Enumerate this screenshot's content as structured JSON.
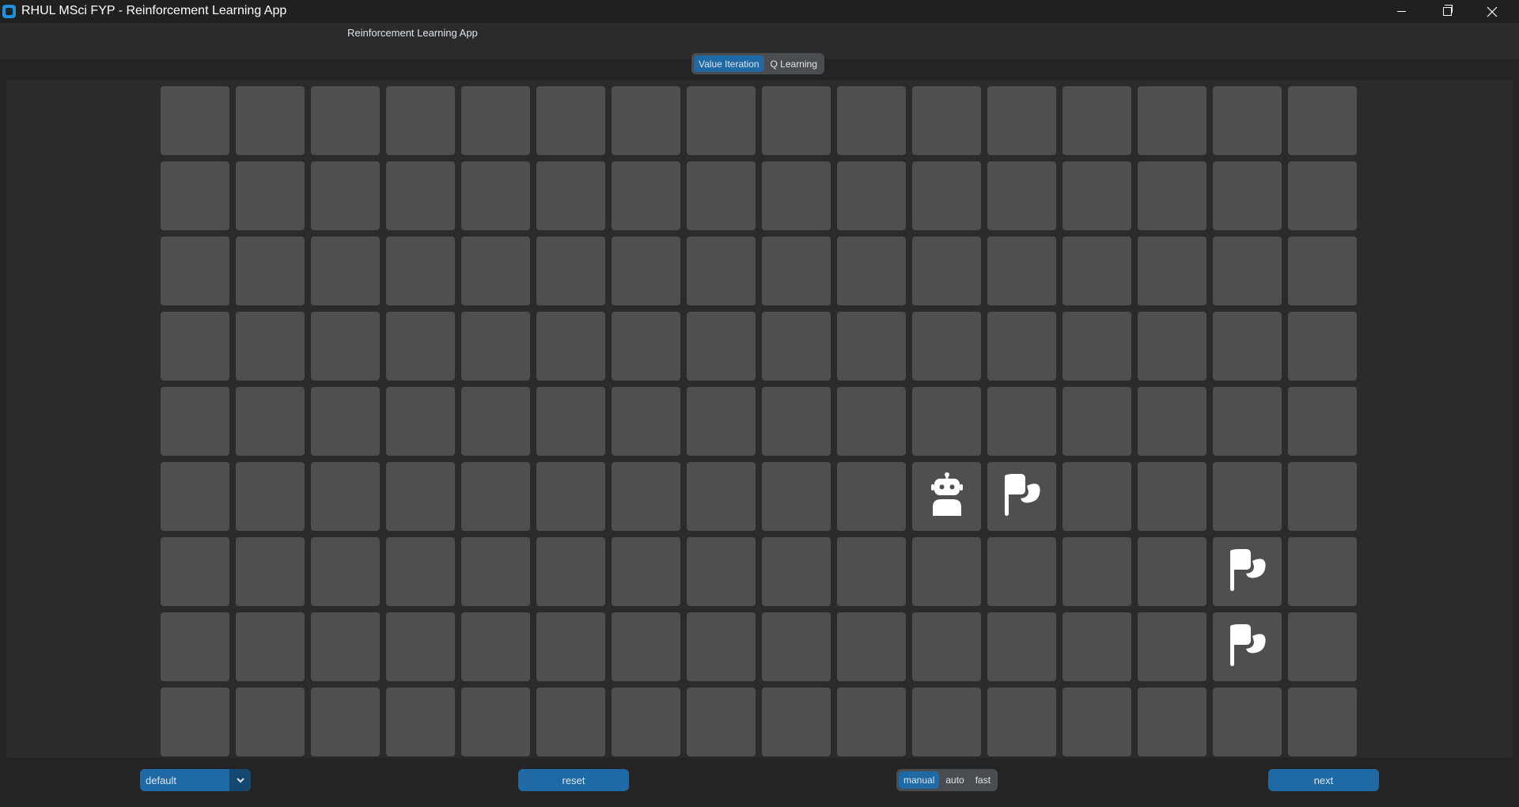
{
  "window": {
    "title": "RHUL MSci FYP - Reinforcement Learning App",
    "controls": {
      "minimize": "–",
      "restore": "❐",
      "close": "✕"
    }
  },
  "header": {
    "title": "Reinforcement Learning App"
  },
  "tabs": [
    {
      "label": "Value Iteration",
      "active": true
    },
    {
      "label": "Q Learning",
      "active": false
    }
  ],
  "grid": {
    "columns": 16,
    "rows": 9,
    "cell_color": "#4f4f4f",
    "robot": {
      "row": 5,
      "col": 10,
      "icon": "robot-icon"
    },
    "flags": [
      {
        "row": 5,
        "col": 11,
        "icon": "flag-icon"
      },
      {
        "row": 6,
        "col": 14,
        "icon": "flag-icon"
      },
      {
        "row": 7,
        "col": 14,
        "icon": "flag-icon"
      }
    ]
  },
  "controls": {
    "map_select": {
      "value": "default"
    },
    "reset_label": "reset",
    "next_label": "next",
    "modes": [
      {
        "label": "manual",
        "active": true
      },
      {
        "label": "auto",
        "active": false
      },
      {
        "label": "fast",
        "active": false
      }
    ]
  },
  "colors": {
    "accent": "#1f6aa5",
    "accent_dark": "#144870",
    "background": "#242424",
    "frame": "#2b2b2b"
  }
}
